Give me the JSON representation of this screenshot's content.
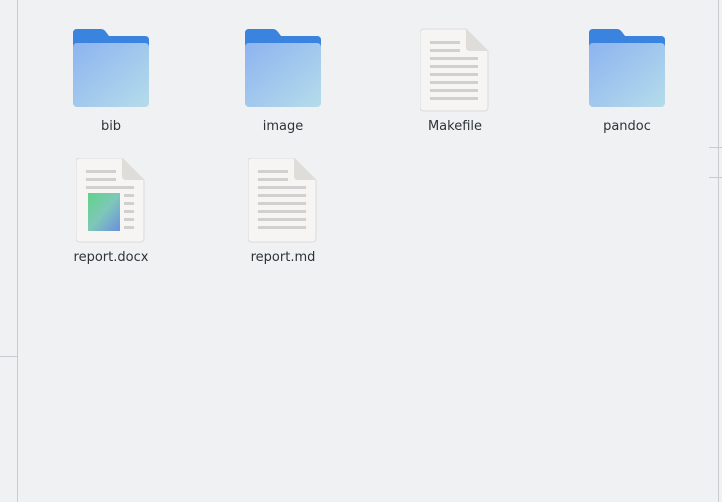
{
  "files": [
    {
      "name": "bib",
      "icon": "folder-icon"
    },
    {
      "name": "image",
      "icon": "folder-icon"
    },
    {
      "name": "Makefile",
      "icon": "text-file-icon"
    },
    {
      "name": "pandoc",
      "icon": "folder-icon"
    },
    {
      "name": "report.docx",
      "icon": "document-file-icon"
    },
    {
      "name": "report.md",
      "icon": "text-file-icon"
    }
  ],
  "colors": {
    "background": "#eff1f3",
    "folder_top": "#3a84e0",
    "folder_body_start": "#8eb7ef",
    "folder_body_end": "#b3daea",
    "file_page": "#f6f5f4",
    "file_lines": "#d0d0d0"
  }
}
